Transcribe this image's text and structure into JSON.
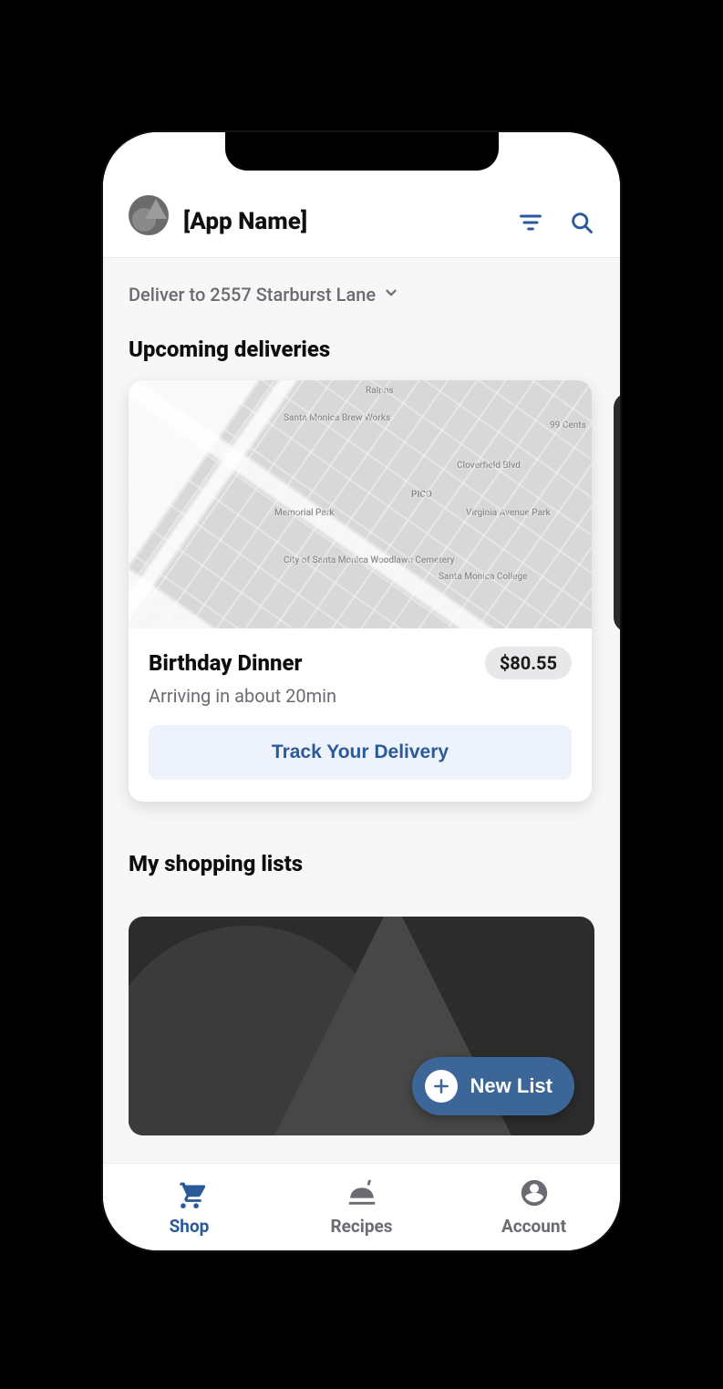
{
  "header": {
    "app_name": "[App Name]"
  },
  "address": {
    "text": "Deliver to 2557 Starburst Lane"
  },
  "sections": {
    "deliveries_title": "Upcoming deliveries",
    "lists_title": "My shopping lists"
  },
  "delivery_card": {
    "name": "Birthday Dinner",
    "price": "$80.55",
    "eta": "Arriving in about 20min",
    "track_label": "Track Your Delivery",
    "map_labels": [
      "Santa Monica Brew Works",
      "Memorial Park",
      "PICO",
      "Virginia Avenue Park",
      "City of Santa Monica Woodlawn Cemetery",
      "Santa Monica College",
      "Cloverfield Blvd",
      "99 Cents",
      "Ralphs"
    ]
  },
  "new_list": {
    "label": "New List"
  },
  "nav": {
    "shop": "Shop",
    "recipes": "Recipes",
    "account": "Account"
  },
  "colors": {
    "accent": "#2b5a9a"
  }
}
